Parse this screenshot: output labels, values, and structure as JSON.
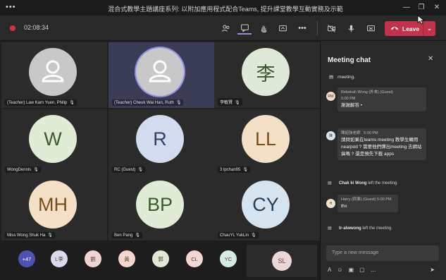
{
  "titlebar": {
    "menu": "•••",
    "title": "混合式教學主題講座系列: 以附加應用程式配合Teams, 提升課堂教學互動實務及示範"
  },
  "toolbar": {
    "timer": "02:08:34",
    "leave_label": "Leave"
  },
  "tiles": [
    {
      "name": "(Teacher) Law Kam Yuen, Philip",
      "initials": "",
      "style": "gray"
    },
    {
      "name": "(Teacher) Cheuk Wai Han, Ruth",
      "initials": "",
      "style": "gray"
    },
    {
      "name": "李敏賢",
      "initials": "李",
      "style": "sage"
    },
    {
      "name": "WongDennis",
      "initials": "W",
      "style": "green"
    },
    {
      "name": "RC (Guest)",
      "initials": "R",
      "style": "blue"
    },
    {
      "name": "3 lpchan95",
      "initials": "LL",
      "style": "peach"
    },
    {
      "name": "Miss Wong Shuk Ha",
      "initials": "MH",
      "style": "peach"
    },
    {
      "name": "Ben Pang",
      "initials": "BP",
      "style": "green"
    },
    {
      "name": "ChauYL YukLin",
      "initials": "CY",
      "style": "cyan"
    }
  ],
  "strip": {
    "more": "+47",
    "avatars": [
      {
        "initials": "L李",
        "color": "#dcd9ee"
      },
      {
        "initials": "劉",
        "color": "#f1d5d3"
      },
      {
        "initials": "黃",
        "color": "#f4d8d0"
      },
      {
        "initials": "郭",
        "color": "#dfe7d5"
      },
      {
        "initials": "CL",
        "color": "#f2d7d3"
      },
      {
        "initials": "YC",
        "color": "#d4ebe2"
      }
    ],
    "speaker": "SL"
  },
  "chat": {
    "header": "Meeting chat",
    "top_fragment": "meeting.",
    "messages": [
      {
        "avatar": "RW",
        "author": "Rebekah Wong (外來) (Guest)",
        "time": "5:00 PM",
        "text": "謝謝解答 •",
        "avatar_color": "#f3d9c7"
      },
      {
        "avatar": "陳",
        "author": "陳紹強老師",
        "time": "5:00 PM",
        "text": "請問如果在teams meeting 教學生轉用nearpod ? 需要他們彈出meeting 去網站搞嗎 ? 還是預先下載 apps",
        "avatar_color": "#d7e6ee"
      },
      {
        "avatar": "H",
        "author": "Harry (同事) (Guest)",
        "time": "5:00 PM",
        "text": "thx",
        "avatar_color": "#f3e2c9"
      }
    ],
    "system": [
      {
        "who": "Chak ki Wong",
        "text": " left the meeting."
      },
      {
        "who": "tr-alwwong",
        "text": " left the meeting."
      }
    ],
    "input_placeholder": "Type a new message"
  },
  "icons": [
    "people-icon",
    "chat-icon",
    "raise-hand-icon",
    "share-tray-icon",
    "more-icon",
    "camera-icon",
    "mic-icon",
    "share-screen-icon",
    "phone-icon"
  ]
}
